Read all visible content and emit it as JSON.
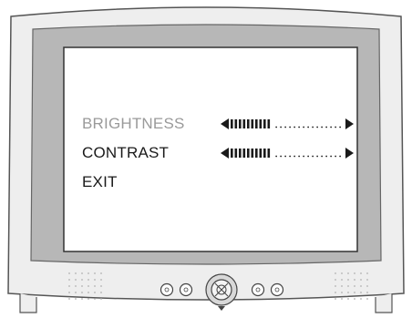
{
  "osd_menu": {
    "items": [
      {
        "label": "BRIGHTNESS",
        "state": "dimmed",
        "level": 0.38
      },
      {
        "label": "CONTRAST",
        "state": "selected",
        "level": 0.38
      },
      {
        "label": "EXIT",
        "state": "normal"
      }
    ]
  },
  "front_panel": {
    "buttons": [
      "button",
      "button",
      "joystick",
      "button",
      "button"
    ]
  },
  "colors": {
    "bezel": "#eeeeee",
    "inner_frame": "#b7b7b7",
    "screen": "#ffffff",
    "text": "#1a1a1a",
    "dim_text": "#9a9a9a"
  }
}
